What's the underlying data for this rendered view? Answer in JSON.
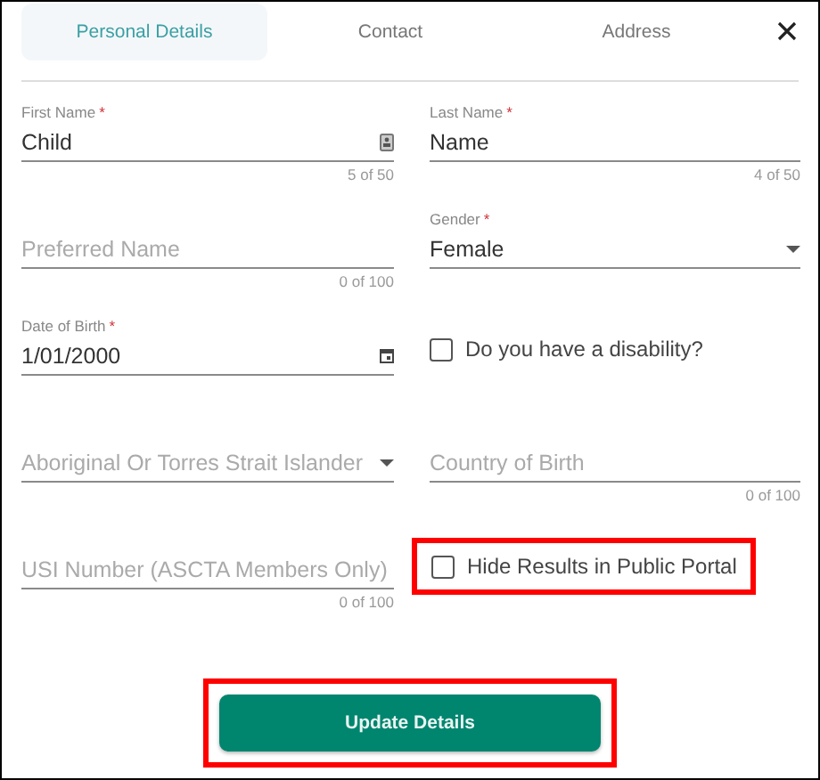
{
  "tabs": [
    {
      "label": "Personal Details",
      "selected": true
    },
    {
      "label": "Contact",
      "selected": false
    },
    {
      "label": "Address",
      "selected": false
    }
  ],
  "fields": [
    {
      "kind": "text",
      "label": "First Name",
      "required_mark": "*",
      "value": "Child",
      "counter": "5 of 50",
      "trailing_icon": true
    },
    {
      "kind": "text",
      "label": "Last Name",
      "required_mark": "*",
      "value": "Name",
      "counter": "4 of 50"
    },
    {
      "kind": "text",
      "placeholder": "Preferred Name",
      "counter": "0 of 100"
    },
    {
      "kind": "select",
      "label": "Gender",
      "required_mark": "*",
      "value": "Female"
    },
    {
      "kind": "date",
      "label": "Date of Birth",
      "required_mark": "*",
      "value": "1/01/2000"
    },
    {
      "kind": "checkbox",
      "label": "Do you have a disability?",
      "checked": false,
      "highlighted": false
    },
    {
      "kind": "select",
      "placeholder": "Aboriginal Or Torres Strait Islander"
    },
    {
      "kind": "text",
      "placeholder": "Country of Birth",
      "counter": "0 of 100"
    },
    {
      "kind": "text",
      "placeholder": "USI Number (ASCTA Members Only)",
      "counter": "0 of 100"
    },
    {
      "kind": "checkbox",
      "label": "Hide Results in Public Portal",
      "checked": false,
      "highlighted": true
    }
  ],
  "submit": {
    "label": "Update Details",
    "highlighted": true
  }
}
